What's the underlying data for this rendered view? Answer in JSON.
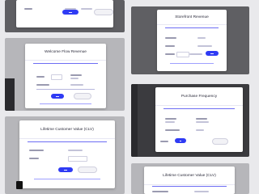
{
  "tiles": {
    "t1": {
      "title": ""
    },
    "t2": {
      "title": "Storefront Revenue"
    },
    "t3": {
      "title": "Welcome Flow Revenue"
    },
    "t4": {
      "title": "Purchase Frequency"
    },
    "t5": {
      "title": "Lifetime Customer Value (CLV)"
    },
    "t6": {
      "title": "Lifetime Customer Value (CLV)"
    }
  }
}
